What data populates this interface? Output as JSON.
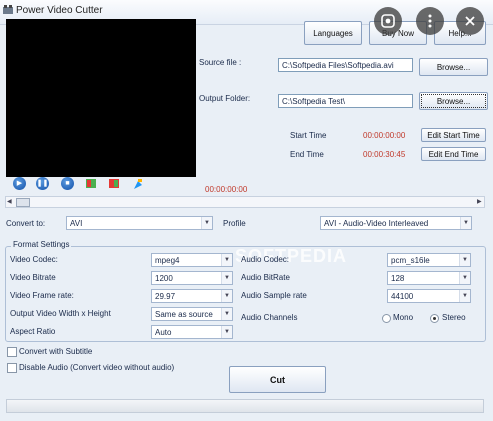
{
  "window": {
    "title": "Power Video Cutter"
  },
  "toolbar": {
    "languages": "Languages",
    "buy_now": "Buy Now",
    "help": "Help..."
  },
  "source": {
    "label": "Source file :",
    "value": "C:\\Softpedia Files\\Softpedia.avi",
    "browse": "Browse..."
  },
  "output": {
    "label": "Output Folder:",
    "value": "C:\\Softpedia Test\\",
    "browse": "Browse..."
  },
  "times": {
    "start_label": "Start Time",
    "start_value": "00:00:00:00",
    "edit_start": "Edit Start Time",
    "end_label": "End Time",
    "end_value": "00:00:30:45",
    "edit_end": "Edit End Time"
  },
  "player": {
    "position": "00:00:00:00"
  },
  "convert": {
    "label": "Convert to:",
    "value": "AVI",
    "profile_label": "Profile",
    "profile_value": "AVI - Audio-Video Interleaved"
  },
  "format": {
    "title": "Format Settings",
    "video_codec_label": "Video Codec:",
    "video_codec": "mpeg4",
    "video_bitrate_label": "Video Bitrate",
    "video_bitrate": "1200",
    "frame_rate_label": "Video Frame rate:",
    "frame_rate": "29.97",
    "size_label": "Output Video Width x Height",
    "size": "Same as source",
    "aspect_label": "Aspect Ratio",
    "aspect": "Auto",
    "audio_codec_label": "Audio Codec:",
    "audio_codec": "pcm_s16le",
    "audio_bitrate_label": "Audio BitRate",
    "audio_bitrate": "128",
    "sample_rate_label": "Audio Sample rate",
    "sample_rate": "44100",
    "channels_label": "Audio Channels",
    "mono": "Mono",
    "stereo": "Stereo"
  },
  "options": {
    "subtitle": "Convert with Subtitle",
    "disable_audio": "Disable Audio (Convert video without audio)"
  },
  "actions": {
    "cut": "Cut"
  },
  "watermark": "SOFTPEDIA"
}
